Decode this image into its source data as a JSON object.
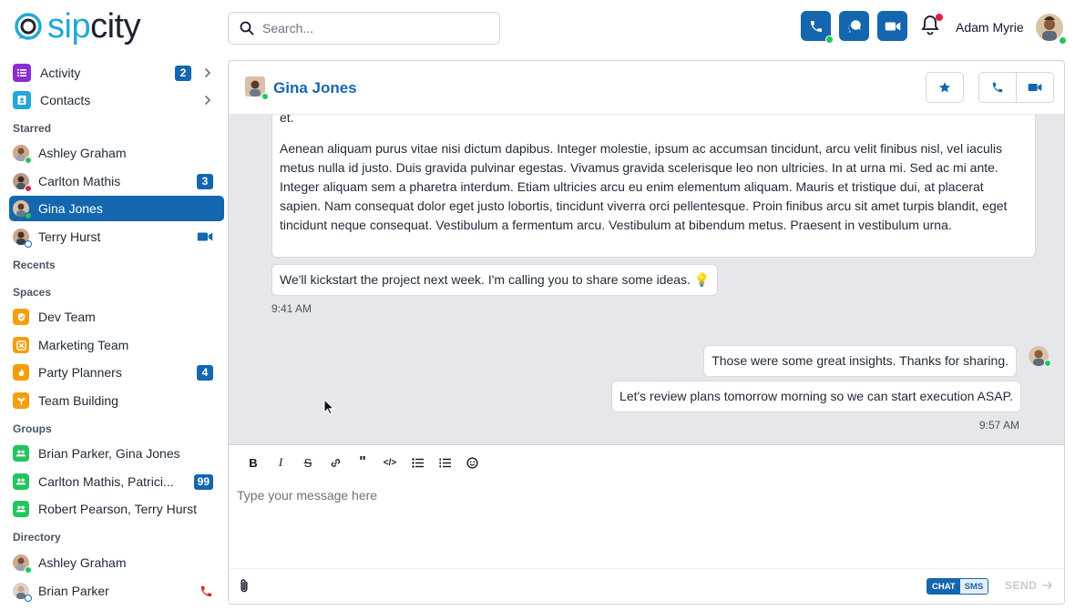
{
  "brand": {
    "sip": "sip",
    "city": "city"
  },
  "search": {
    "placeholder": "Search..."
  },
  "user": {
    "name": "Adam Myrie"
  },
  "sidebar": {
    "top_items": [
      {
        "label": "Activity",
        "badge": "2"
      },
      {
        "label": "Contacts"
      }
    ],
    "sections": {
      "starred": "Starred",
      "recents": "Recents",
      "spaces": "Spaces",
      "groups": "Groups",
      "directory": "Directory"
    },
    "starred": [
      {
        "label": "Ashley Graham"
      },
      {
        "label": "Carlton Mathis",
        "badge": "3"
      },
      {
        "label": "Gina Jones"
      },
      {
        "label": "Terry Hurst"
      }
    ],
    "spaces": [
      {
        "label": "Dev Team"
      },
      {
        "label": "Marketing Team"
      },
      {
        "label": "Party Planners",
        "badge": "4"
      },
      {
        "label": "Team Building"
      }
    ],
    "groups": [
      {
        "label": "Brian Parker, Gina Jones"
      },
      {
        "label": "Carlton Mathis, Patrici...",
        "badge": "99"
      },
      {
        "label": "Robert Pearson, Terry Hurst"
      }
    ],
    "directory": [
      {
        "label": "Ashley Graham"
      },
      {
        "label": "Brian Parker"
      }
    ]
  },
  "chat": {
    "contact_name": "Gina Jones",
    "messages": {
      "m0_tail": "et.",
      "m1": "Aenean aliquam purus vitae nisi dictum dapibus. Integer molestie, ipsum ac accumsan tincidunt, arcu velit finibus nisl, vel iaculis metus nulla id justo. Duis gravida pulvinar egestas. Vivamus gravida scelerisque leo non ultricies. In at urna mi. Sed ac mi ante. Integer aliquam sem a pharetra interdum. Etiam ultricies arcu eu enim elementum aliquam. Mauris et tristique dui, at placerat sapien. Nam consequat dolor eget justo lobortis, tincidunt viverra orci pellentesque. Proin finibus arcu sit amet turpis blandit, eget tincidunt neque consequat. Vestibulum a fermentum arcu. Vestibulum at bibendum metus. Praesent in vestibulum urna.",
      "m2": "We'll kickstart the project next week. I'm calling you to share some ideas. 💡",
      "m2_time": "9:41 AM",
      "m3": "Those were some great insights. Thanks for sharing.",
      "m4": "Let's review plans tomorrow morning so we can start execution ASAP.",
      "m4_time": "9:57 AM"
    },
    "composer": {
      "placeholder": "Type your message here",
      "chat_label": "CHAT",
      "sms_label": "SMS",
      "send_label": "SEND"
    }
  },
  "colors": {
    "brand_blue": "#1467ae",
    "sip_cyan": "#22a8d6",
    "presence_green": "#22c55e",
    "alert_red": "#e11d48"
  }
}
